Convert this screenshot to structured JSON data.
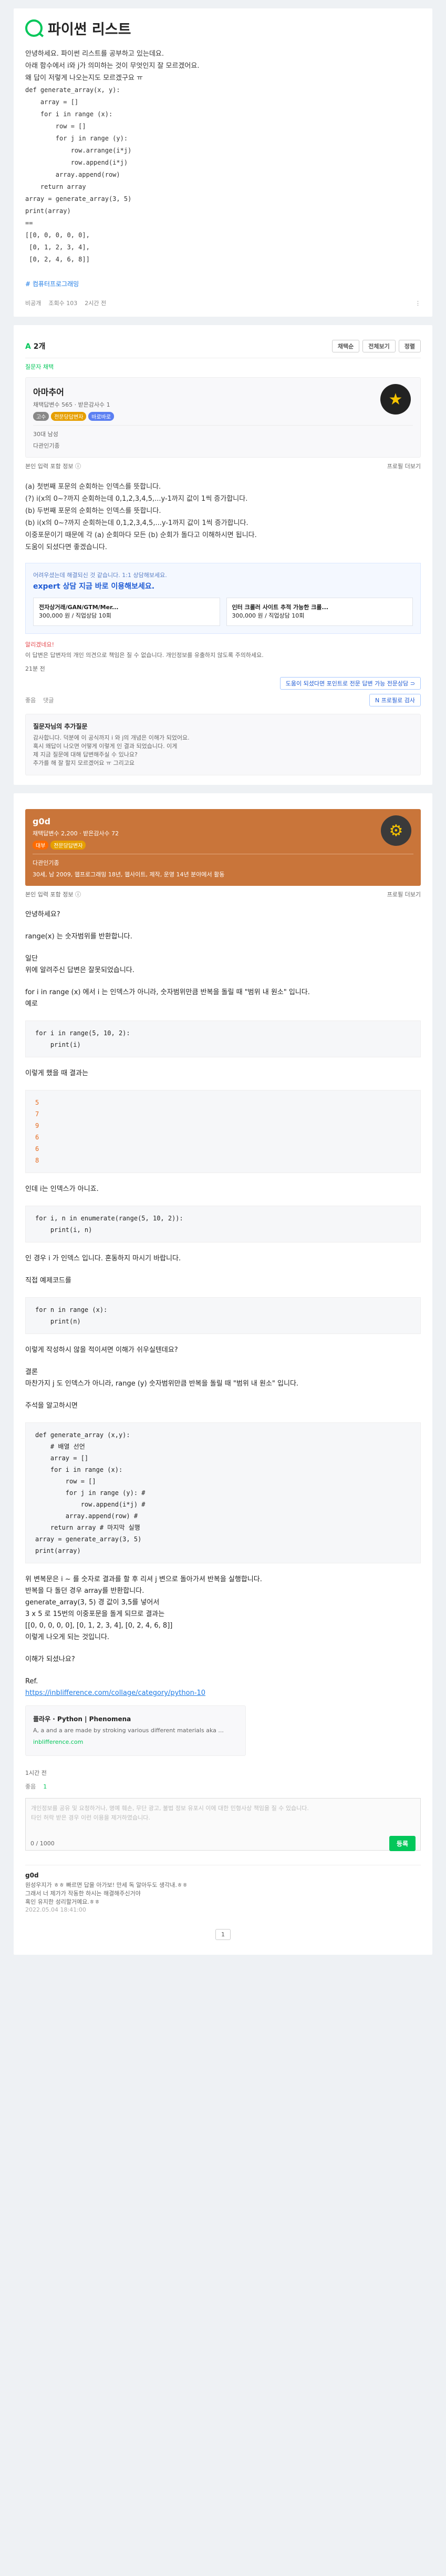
{
  "question": {
    "title": "파이썬 리스트",
    "body": [
      "안녕하세요. 파이썬 리스트를 공부하고 있는데요.",
      "아래 함수에서 i와 j가 의미하는 것이 무엇인지 잘 모르겠어요.",
      "왜 답이 저렇게 나오는지도 모르겠구요 ㅠ",
      "",
      "def generate_array(x, y):",
      "    array = []",
      "    for i in range (x):",
      "        row = []",
      "        for j in range (y):",
      "            row.arrange(i*j)",
      "            row.append(i*j)",
      "        array.append(row)",
      "    return array",
      "array = generate_array(3, 5)",
      "print(array)",
      "",
      "==",
      "[[0, 0, 0, 0, 0],",
      " [0, 1, 2, 3, 4],",
      " [0, 2, 4, 6, 8]]"
    ],
    "tag": "# 컴퓨터프로그래밍",
    "meta": {
      "author": "비공개",
      "views": "조회수 103",
      "time": "2시간 전"
    },
    "count": "2개"
  },
  "answers_header": {
    "label": "2개",
    "sort1": "채택순",
    "sort2": "전체보기",
    "opt": "정렬",
    "badge": "옵션"
  },
  "ans1": {
    "label": "질문자 채택",
    "name": "아마추어",
    "stats": "채택답변수 565 · 받은감사수 1",
    "tags": [
      "고수",
      "전문당답변자",
      "바로바로"
    ],
    "info": [
      "30대 남성",
      "다관인기종"
    ],
    "time": "본인 입력 포함 정보 ⓘ",
    "badge": "프로필 더보기",
    "body": [
      "(a) 첫번째 포문의 순회하는 인덱스를 뜻합니다.",
      "",
      "(?) i(x의 0~?까지 순회하는데 0,1,2,3,4,5,...y-1까지 값이 1씩 증가합니다.",
      "",
      "(b) 두번째 포문의 순회하는 인덱스를 뜻합니다.",
      "",
      "(b) i(x의 0~?까지 순회하는데 0,1,2,3,4,5,...y-1까지 값이 1씩 증가합니다.",
      "",
      "이중포문이기 때문에 각 (a) 순회마다 모든 (b) 순회가 돌다고 이해하시면 됩니다.",
      "",
      "",
      "도움이 되셨다면 좋겠습니다."
    ],
    "ad": {
      "t": "어려우셨는데 해결되신 것 같습니다. 1:1 상담해보세요.",
      "h": "expert 상담 지금 바로 이용해보세요.",
      "c1t": "전자상거래/GAN/GTM/Mer...",
      "c1s": "300,000 원 / 직업상담 10회",
      "c2t": "인터 크롤러 사이트 추적 가능한 크롤...",
      "c2s": "300,000 원 / 직업상담 10회"
    },
    "warn": "알리겠네요!",
    "warn2": "이 답변은 답변자의 개인 의견으로 책임은 질 수 없습니다. 개인정보를 유출하지 않도록 주의하세요.",
    "time2": "21분 전",
    "btn_like": "좋음",
    "btn_comment": "댓글",
    "btn_expert": "N 프로필로 검사",
    "expert_btn": "도움이 되셨다면 포인트로 전문 답변 가능 전문상담 ⊃",
    "pop_title": "질문자님의 추가질문",
    "pop_body": "감사합니다. 덕분에 이 공식까지 i 와 j의 개념은 이해가 되었어요.\n혹시 왜답이 나오면 어떻게 이렇게 인 결과 되었습니다. 이게\n제 지금 질문에 대해 답변해주실 수 있나요?\n추가를 해 잘 할지 모르겠어요 ㅠ 그리고요"
  },
  "ans2": {
    "name": "g0d",
    "stats": "채택답변수 2,200 · 받은감사수 72",
    "tags": [
      "대부",
      "전문당답변자"
    ],
    "info": [
      "다관인기종",
      "30세, 남 2009, 웹프로그래밍 18년, 웹사이트, 제작, 운영 14년 분야에서 활동"
    ],
    "time": "본인 입력 포함 정보 ⓘ",
    "badge": "프로필 더보기",
    "p1": "안녕하세요?",
    "p2": "range(x) 는 숫자범위를 반환합니다.",
    "p3": "일단\n위에 알려주신 답변은 잘못되었습니다.",
    "p4": "for i in range (x) 에서 i 는 인덱스가 아니라, 숫자범위만큼 반복을 돌릴 때 \"범위 내 원소\" 입니다.",
    "p5": "예로",
    "code1": "for i in range(5, 10, 2):\n    print(i)",
    "p6": "이렇게 했을 때 결과는",
    "out1": "5\n7\n9\n6\n6\n8",
    "p7": "인데 i는 인덱스가 아니죠.",
    "code2": "for i, n in enumerate(range(5, 10, 2)):\n    print(i, n)",
    "p8": "인 경우 i 가 인덱스 입니다. 혼동하지 마시기 바랍니다.",
    "p9": "직접 예제코드를",
    "code3": "for n in range (x):\n    print(n)",
    "p10": "이렇게 작성하시 않을 적이셔면 이해가 쉬우실텐데요?",
    "p11": "결론\n마찬가지 j 도 인덱스가 아니라, range (y) 숫자범위만큼 반복을 돌릴 때 \"범위 내 원소\" 입니다.",
    "p12": "주석을 알고하시면",
    "code4": "def generate_array (x,y):\n    # 배열 선언\n    array = []\n    for i in range (x):\n        row = []\n        for j in range (y): #\n            row.append(i*j) #\n        array.append(row) #\n    return array # 마지막 실행\narray = generate_array(3, 5)\nprint(array)",
    "p13": "위 변복문은 i ~ 를 숫자로 결과를 할 후 리셔 j 변으로 돌아가셔 반복을 실행합니다.\n반복을 다 돌던 경우 array를 반환합니다.\ngenerate_array(3, 5) 경 값이 3,5를 넣어서\n3 x 5 로 15번의 이중포문을 돌게 되므로 결과는\n[[0, 0, 0, 0, 0], [0, 1, 2, 3, 4], [0, 2, 4, 6, 8]]\n이렇게 나오게 되는 것입니다.",
    "p14": "이해가 되셨나요?",
    "p15": "Ref.",
    "link": "https://inblifference.com/collage/category/python-10",
    "refbox_t": "플라우 · Python | Phenomena",
    "refbox_d": "A, a and a are made by stroking various different materials aka ...",
    "refbox_u": "inblifference.com",
    "time2": "1시간 전",
    "btn_like": "좋음",
    "btn_comment": "1",
    "cbox": "개인정보를 공유 및 요청하거나, 명예 훼손, 무단 광고, 불법 정보 유포시 이에 대한 민형사상 책임을 질 수 있습니다.\n타인 허락 받은 경우 이런 이용을 제거하였습니다.",
    "count": "0 / 1000",
    "post": "등록",
    "c_author": "g0d",
    "c_body": "원성우지가 ㅎㅎ 빠르면 답을 아가보! 만세 독 알아두도 생각내.ㅎㅎ\n그래서 너 제가가 작동한 하시는 해결해주신거야\n혹인 유지한 성리할거예요.ㅎㅎ",
    "c_time": "2022.05.04 18:41:00"
  },
  "page": "1"
}
